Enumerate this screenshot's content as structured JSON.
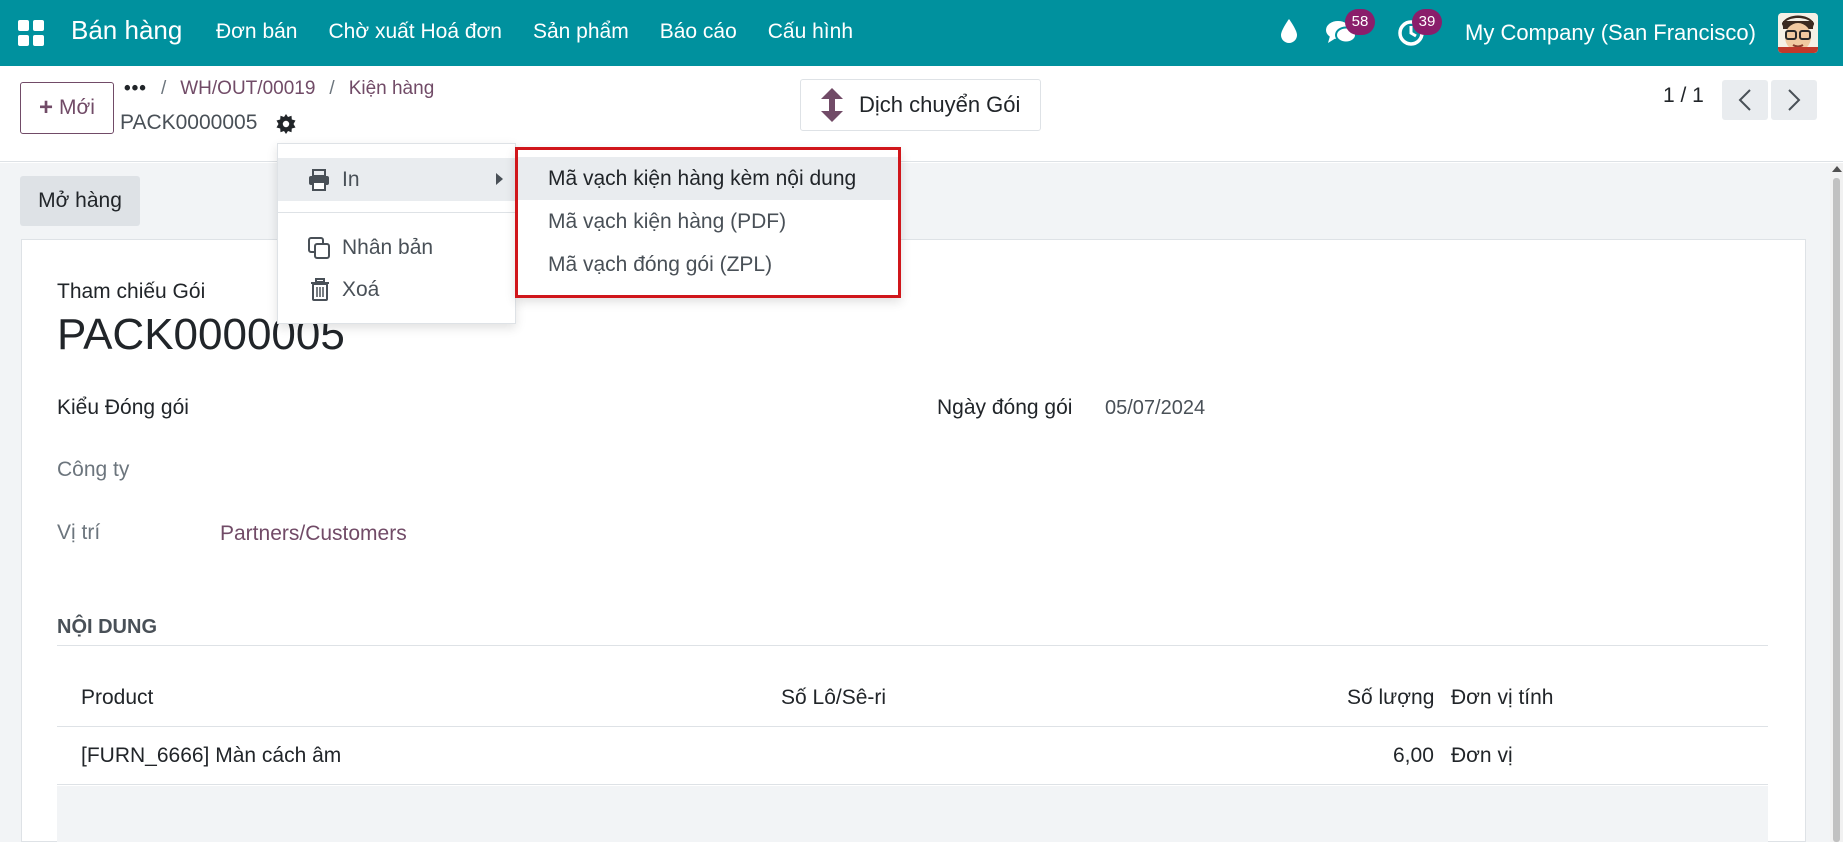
{
  "navbar": {
    "app_name": "Bán hàng",
    "menu": [
      "Đơn bán",
      "Chờ xuất Hoá đơn",
      "Sản phẩm",
      "Báo cáo",
      "Cấu hình"
    ],
    "chat_count": "58",
    "activity_count": "39",
    "company": "My Company (San Francisco)"
  },
  "control": {
    "new_label": "Mới",
    "breadcrumb_dots": "•••",
    "breadcrumb": [
      "WH/OUT/00019",
      "Kiện hàng"
    ],
    "breadcrumb_sep": "/",
    "record_name": "PACK0000005",
    "move_label": "Dịch chuyển Gói",
    "pager": "1 / 1"
  },
  "actions": {
    "print_label": "In",
    "duplicate_label": "Nhân bản",
    "delete_label": "Xoá"
  },
  "print_submenu": [
    "Mã vạch kiện hàng kèm nội dung",
    "Mã vạch kiện hàng (PDF)",
    "Mã vạch đóng gói (ZPL)"
  ],
  "form": {
    "open_button": "Mở hàng",
    "ref_label": "Tham chiếu Gói",
    "ref_value": "PACK0000005",
    "package_type_label": "Kiểu Đóng gói",
    "pack_date_label": "Ngày đóng gói",
    "pack_date_value": "05/07/2024",
    "company_label": "Công ty",
    "location_label": "Vị trí",
    "location_value": "Partners/Customers",
    "section_title": "NỘI DUNG"
  },
  "table": {
    "headers": [
      "Product",
      "Số Lô/Sê-ri",
      "Số lượng",
      "Đơn vị tính"
    ],
    "rows": [
      {
        "product": "[FURN_6666] Màn cách âm",
        "lot": "",
        "qty": "6,00",
        "uom": "Đơn vị"
      }
    ]
  },
  "colors": {
    "navbar": "#00919e",
    "primary": "#714b67",
    "badge": "#8a1e6b",
    "highlight_border": "#d0161b"
  }
}
